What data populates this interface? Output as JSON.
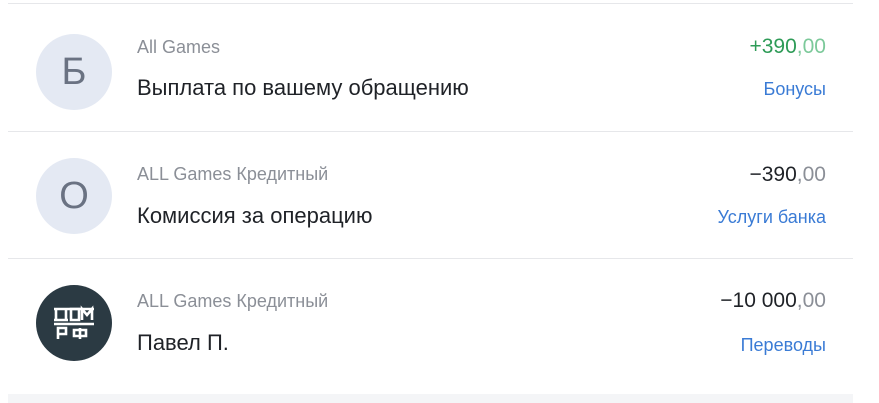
{
  "transactions": [
    {
      "avatar_letter": "Б",
      "source": "All Games",
      "title": "Выплата по вашему обращению",
      "amount_int": "+390",
      "amount_frac": ",00",
      "category": "Бонусы"
    },
    {
      "avatar_letter": "О",
      "source": "ALL Games Кредитный",
      "title": "Комиссия за операцию",
      "amount_int": "−390",
      "amount_frac": ",00",
      "category": "Услуги банка"
    },
    {
      "avatar_icon": "dom-rf-logo-icon",
      "source": "ALL Games Кредитный",
      "title": "Павел П.",
      "amount_int": "−10 000",
      "amount_frac": ",00",
      "category": "Переводы"
    }
  ],
  "colors": {
    "positive": "#2e9b57",
    "link": "#3a7bd5",
    "muted": "#8b8f97"
  }
}
